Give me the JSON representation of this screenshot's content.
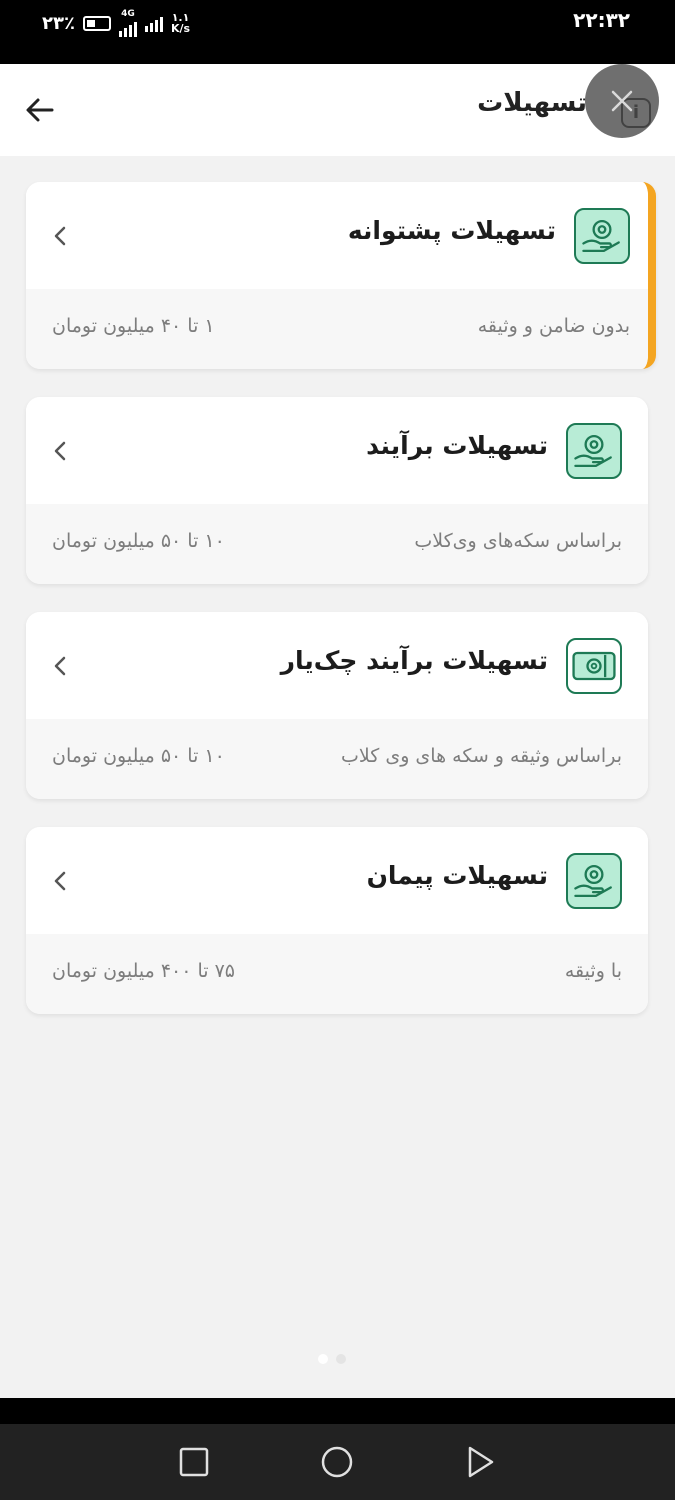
{
  "status_bar": {
    "battery": "۲۳٪",
    "network_type": "4G",
    "network_speed": "۱.۱",
    "speed_unit": "K/s",
    "time": "۲۲:۳۲"
  },
  "header": {
    "title": "تسهیلات",
    "back_icon": "arrow-left-icon",
    "info_icon": "info-icon",
    "info_glyph": "i"
  },
  "overlay": {
    "close_icon": "close-icon"
  },
  "cards": [
    {
      "title": "تسهیلات پشتوانه",
      "description": "بدون ضامن و وثیقه",
      "range": "۱ تا ۴۰ میلیون تومان",
      "active": true,
      "icon": "hand-coin-icon"
    },
    {
      "title": "تسهیلات برآیند",
      "description": "براساس سکه‌های وی‌کلاب",
      "range": "۱۰ تا ۵۰ میلیون تومان",
      "active": false,
      "icon": "hand-coin-icon"
    },
    {
      "title": "تسهیلات برآیند چک‌یار",
      "description": "براساس وثیقه و سکه های وی کلاب",
      "range": "۱۰ تا ۵۰ میلیون تومان",
      "active": false,
      "icon": "banknote-icon"
    },
    {
      "title": "تسهیلات پیمان",
      "description": "با وثیقه",
      "range": "۷۵ تا ۴۰۰ میلیون تومان",
      "active": false,
      "icon": "hand-coin-icon"
    }
  ],
  "colors": {
    "accent": "#f4a521",
    "icon_bg": "#b8ecd6",
    "icon_stroke": "#1e7a55",
    "page_bg": "#f2f2f2"
  },
  "nav_bar": {
    "icons": [
      "recent-apps-icon",
      "home-icon",
      "back-triangle-icon"
    ]
  }
}
